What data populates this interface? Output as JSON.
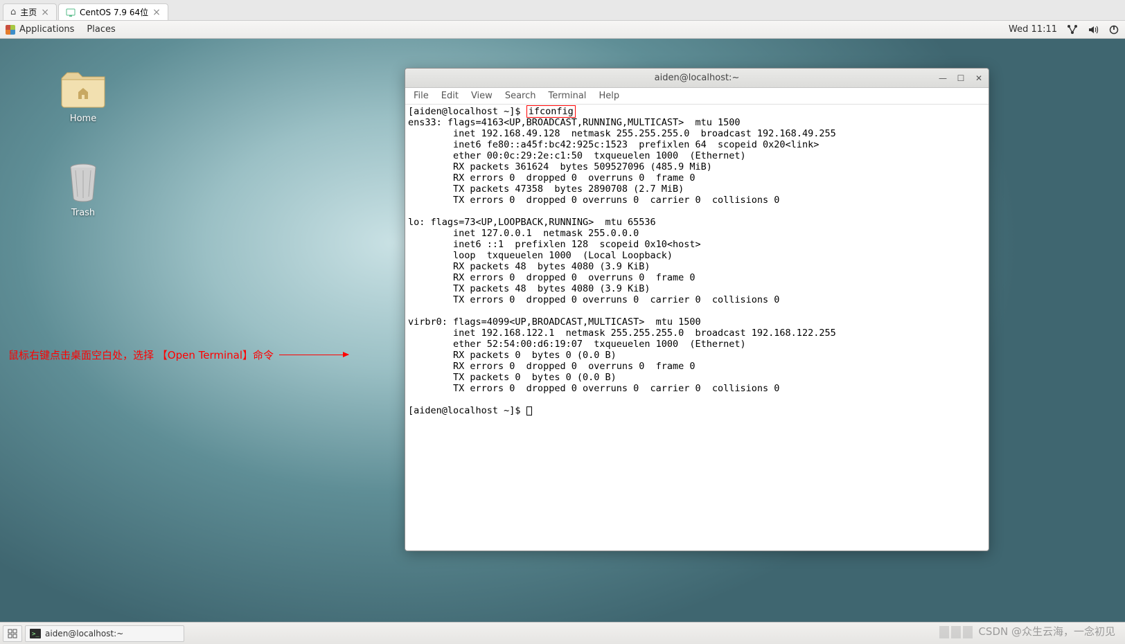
{
  "browser_tabs": {
    "home": {
      "label": "主页"
    },
    "vm": {
      "label": "CentOS 7.9 64位"
    }
  },
  "gnome": {
    "applications": "Applications",
    "places": "Places",
    "clock": "Wed 11:11"
  },
  "desktop_icons": {
    "home": "Home",
    "trash": "Trash"
  },
  "annotation": "鼠标右键点击桌面空白处，选择 【Open Terminal】命令",
  "terminal": {
    "title": "aiden@localhost:~",
    "menu": {
      "file": "File",
      "edit": "Edit",
      "view": "View",
      "search": "Search",
      "terminal": "Terminal",
      "help": "Help"
    },
    "prompt1": "[aiden@localhost ~]$ ",
    "command": "ifconfig",
    "output": "ens33: flags=4163<UP,BROADCAST,RUNNING,MULTICAST>  mtu 1500\n        inet 192.168.49.128  netmask 255.255.255.0  broadcast 192.168.49.255\n        inet6 fe80::a45f:bc42:925c:1523  prefixlen 64  scopeid 0x20<link>\n        ether 00:0c:29:2e:c1:50  txqueuelen 1000  (Ethernet)\n        RX packets 361624  bytes 509527096 (485.9 MiB)\n        RX errors 0  dropped 0  overruns 0  frame 0\n        TX packets 47358  bytes 2890708 (2.7 MiB)\n        TX errors 0  dropped 0 overruns 0  carrier 0  collisions 0\n\nlo: flags=73<UP,LOOPBACK,RUNNING>  mtu 65536\n        inet 127.0.0.1  netmask 255.0.0.0\n        inet6 ::1  prefixlen 128  scopeid 0x10<host>\n        loop  txqueuelen 1000  (Local Loopback)\n        RX packets 48  bytes 4080 (3.9 KiB)\n        RX errors 0  dropped 0  overruns 0  frame 0\n        TX packets 48  bytes 4080 (3.9 KiB)\n        TX errors 0  dropped 0 overruns 0  carrier 0  collisions 0\n\nvirbr0: flags=4099<UP,BROADCAST,MULTICAST>  mtu 1500\n        inet 192.168.122.1  netmask 255.255.255.0  broadcast 192.168.122.255\n        ether 52:54:00:d6:19:07  txqueuelen 1000  (Ethernet)\n        RX packets 0  bytes 0 (0.0 B)\n        RX errors 0  dropped 0  overruns 0  frame 0\n        TX packets 0  bytes 0 (0.0 B)\n        TX errors 0  dropped 0 overruns 0  carrier 0  collisions 0\n",
    "prompt2": "[aiden@localhost ~]$ "
  },
  "taskbar": {
    "app": "aiden@localhost:~"
  },
  "watermark": "CSDN @众生云海，一念初见"
}
